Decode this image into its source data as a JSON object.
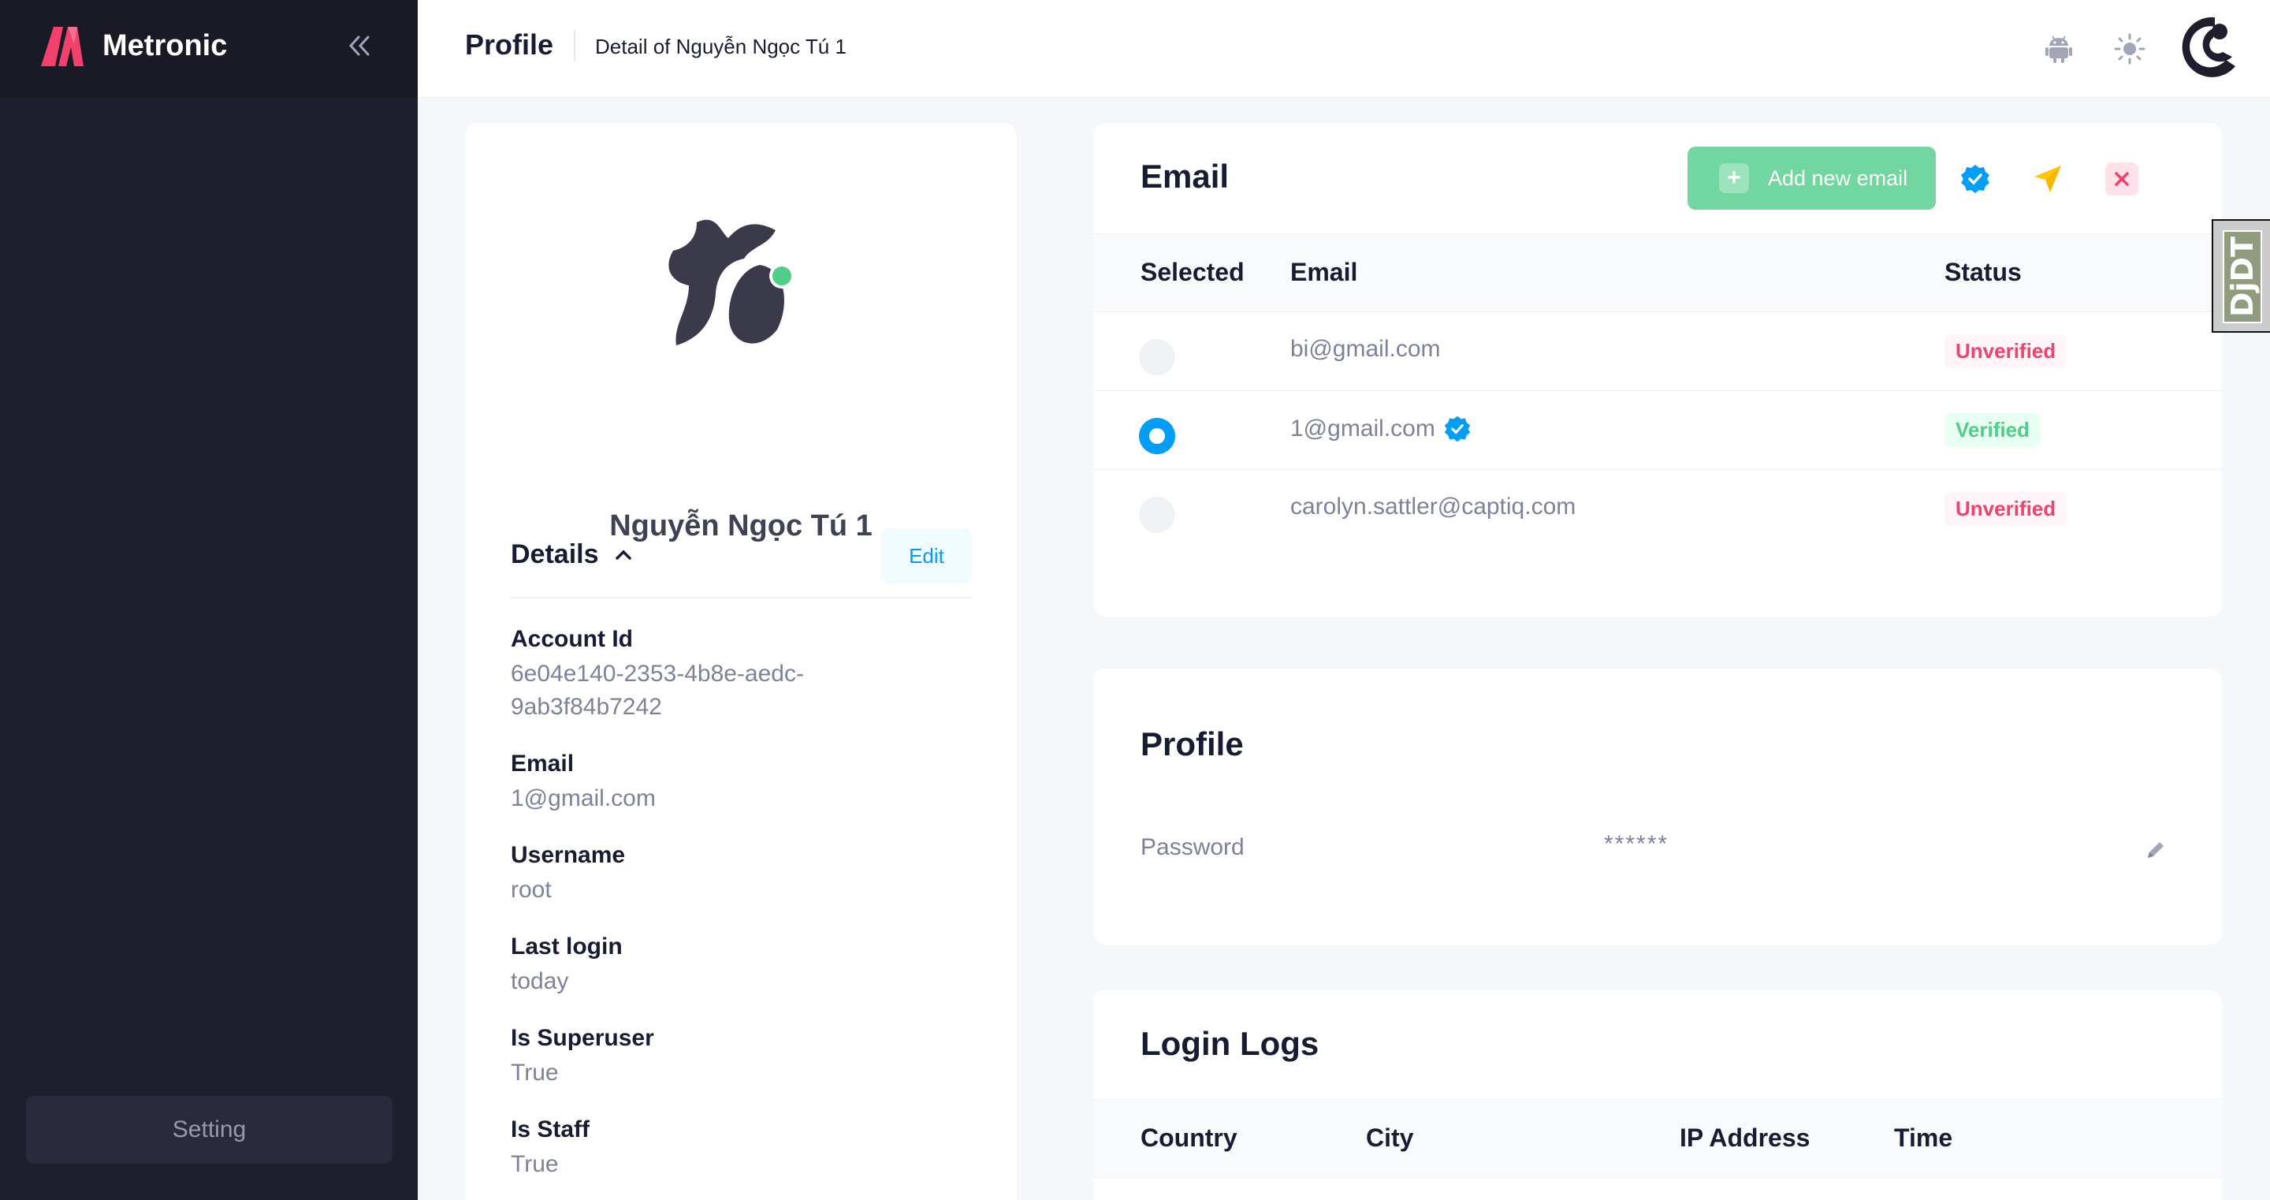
{
  "sidebar": {
    "brand": "Metronic",
    "setting_label": "Setting"
  },
  "header": {
    "title": "Profile",
    "subtitle": "Detail of Nguyễn Ngọc Tú 1",
    "icons": [
      "android-icon",
      "sun-icon",
      "avatar"
    ]
  },
  "profile_card": {
    "name": "Nguyễn Ngọc Tú 1",
    "online_status_color": "#50cd89",
    "details_title": "Details",
    "edit_label": "Edit",
    "fields": [
      {
        "label": "Account Id",
        "value": "6e04e140-2353-4b8e-aedc-9ab3f84b7242"
      },
      {
        "label": "Email",
        "value": "1@gmail.com"
      },
      {
        "label": "Username",
        "value": "root"
      },
      {
        "label": "Last login",
        "value": "today"
      },
      {
        "label": "Is Superuser",
        "value": "True"
      },
      {
        "label": "Is Staff",
        "value": "True"
      }
    ]
  },
  "email_card": {
    "title": "Email",
    "add_label": "Add new email",
    "columns": [
      "Selected",
      "Email",
      "Status"
    ],
    "rows": [
      {
        "email": "bi@gmail.com",
        "selected": false,
        "verified_icon": false,
        "status": "Unverified"
      },
      {
        "email": "1@gmail.com",
        "selected": true,
        "verified_icon": true,
        "status": "Verified"
      },
      {
        "email": "carolyn.sattler@captiq.com",
        "selected": false,
        "verified_icon": false,
        "status": "Unverified"
      }
    ]
  },
  "password_card": {
    "title": "Profile",
    "password_label": "Password",
    "password_value": "******"
  },
  "logs_card": {
    "title": "Login Logs",
    "columns": [
      "Country",
      "City",
      "IP Address",
      "Time"
    ]
  },
  "debug_toolbar": {
    "label": "DjDT"
  },
  "colors": {
    "sidebar_bg": "#1e1e2d",
    "accent": "#009ef7",
    "success": "#50cd89",
    "danger": "#f1416c",
    "warning": "#ffc700"
  }
}
